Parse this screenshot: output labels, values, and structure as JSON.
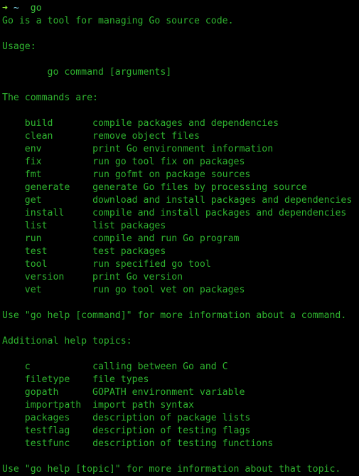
{
  "terminal": {
    "background_color": "#000000",
    "foreground_color": "#2fb42f",
    "prompt": {
      "arrow_glyph": "➜",
      "arrow_color": "#8ae234",
      "path": "~",
      "path_color": "#7fd3e8",
      "command": "go",
      "command_color": "#3ac13a"
    },
    "output": {
      "intro": "Go is a tool for managing Go source code.",
      "usage_label": "Usage:",
      "usage_line": "go command [arguments]",
      "commands_header": "The commands are:",
      "commands": [
        {
          "name": "build",
          "desc": "compile packages and dependencies"
        },
        {
          "name": "clean",
          "desc": "remove object files"
        },
        {
          "name": "env",
          "desc": "print Go environment information"
        },
        {
          "name": "fix",
          "desc": "run go tool fix on packages"
        },
        {
          "name": "fmt",
          "desc": "run gofmt on package sources"
        },
        {
          "name": "generate",
          "desc": "generate Go files by processing source"
        },
        {
          "name": "get",
          "desc": "download and install packages and dependencies"
        },
        {
          "name": "install",
          "desc": "compile and install packages and dependencies"
        },
        {
          "name": "list",
          "desc": "list packages"
        },
        {
          "name": "run",
          "desc": "compile and run Go program"
        },
        {
          "name": "test",
          "desc": "test packages"
        },
        {
          "name": "tool",
          "desc": "run specified go tool"
        },
        {
          "name": "version",
          "desc": "print Go version"
        },
        {
          "name": "vet",
          "desc": "run go tool vet on packages"
        }
      ],
      "command_help_hint": "Use \"go help [command]\" for more information about a command.",
      "topics_header": "Additional help topics:",
      "topics": [
        {
          "name": "c",
          "desc": "calling between Go and C"
        },
        {
          "name": "filetype",
          "desc": "file types"
        },
        {
          "name": "gopath",
          "desc": "GOPATH environment variable"
        },
        {
          "name": "importpath",
          "desc": "import path syntax"
        },
        {
          "name": "packages",
          "desc": "description of package lists"
        },
        {
          "name": "testflag",
          "desc": "description of testing flags"
        },
        {
          "name": "testfunc",
          "desc": "description of testing functions"
        }
      ],
      "topic_help_hint": "Use \"go help [topic]\" for more information about that topic."
    }
  }
}
